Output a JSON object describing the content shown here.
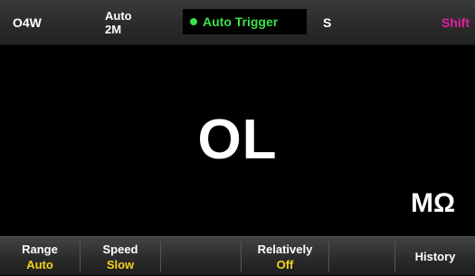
{
  "status_bar": {
    "mode": "O4W",
    "range_line1": "Auto",
    "range_line2": "2M",
    "trigger": "Auto Trigger",
    "speed": "S",
    "shift": "Shift"
  },
  "display": {
    "reading": "OL",
    "unit": "MΩ"
  },
  "softkeys": [
    {
      "label": "Range",
      "value": "Auto"
    },
    {
      "label": "Speed",
      "value": "Slow"
    },
    {
      "label": "",
      "value": ""
    },
    {
      "label": "Relatively",
      "value": "Off"
    },
    {
      "label": "",
      "value": ""
    },
    {
      "label": "History",
      "value": ""
    }
  ],
  "colors": {
    "trigger": "#39e04a",
    "shift": "#e020a0",
    "softkey_value": "#f2d31a"
  },
  "icons": {
    "trigger_indicator": "green-dot-icon"
  }
}
